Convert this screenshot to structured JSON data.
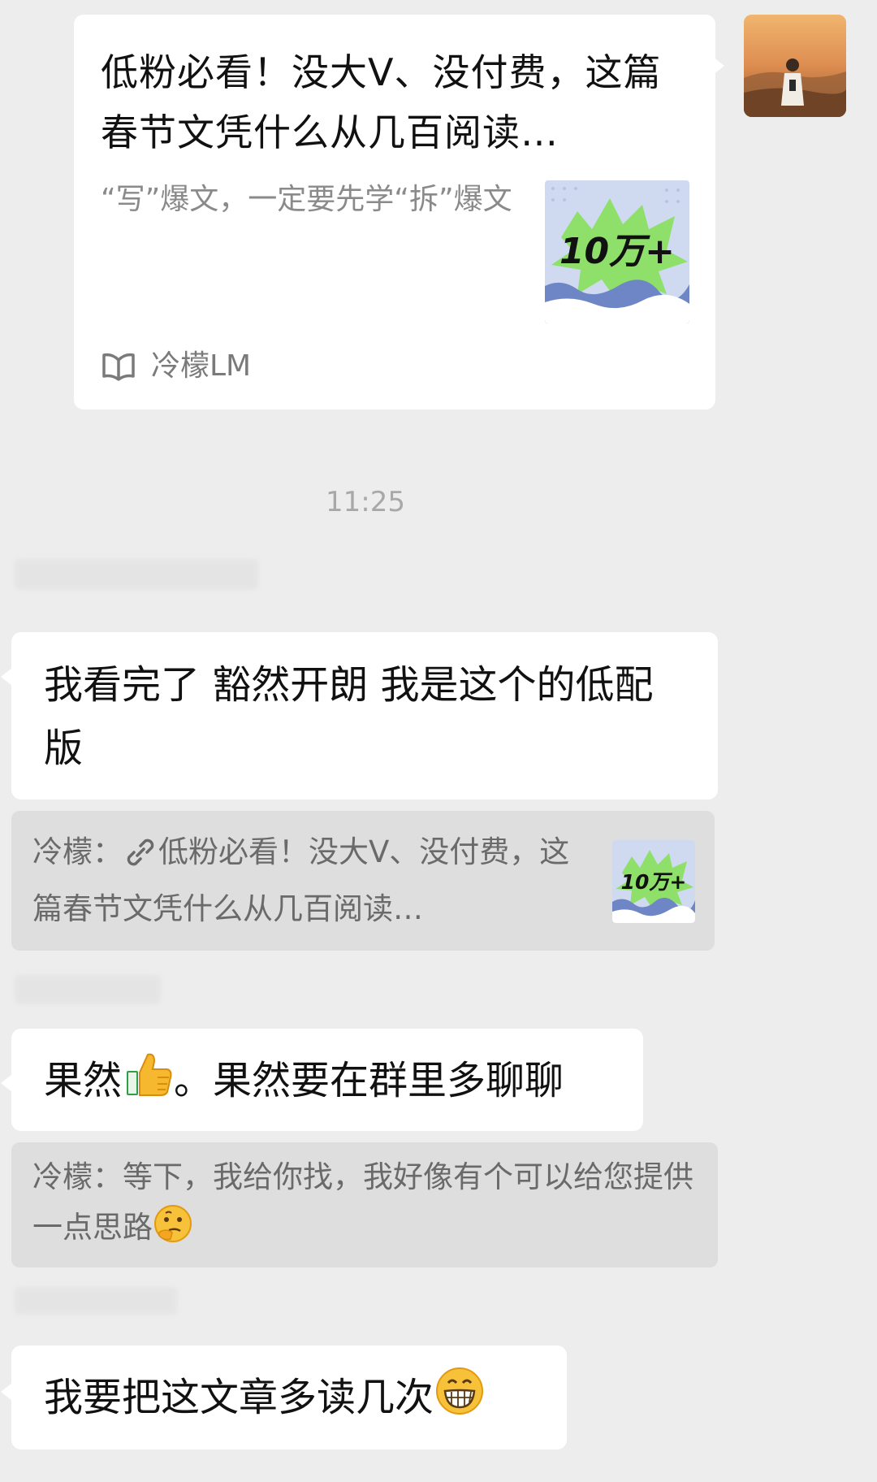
{
  "shared_article": {
    "title": "低粉必看！没大V、没付费，这篇春节文凭什么从几百阅读…",
    "description": "“写”爆文，一定要先学“拆”爆文",
    "source": "冷檬LM",
    "thumbnail_text": "10万+"
  },
  "timestamp": "11:25",
  "messages": [
    {
      "text": "我看完了 豁然开朗 我是这个的低配版",
      "quote": {
        "author": "冷檬：",
        "text": "低粉必看！没大V、没付费，这篇春节文凭什么从几百阅读…",
        "thumbnail_text": "10万+",
        "icon": "link-icon"
      }
    },
    {
      "text_before": "果然",
      "emoji": "thumbs-up-icon",
      "text_after": "。果然要在群里多聊聊",
      "quote": {
        "author": "冷檬：",
        "text": "等下，我给你找，我好像有个可以给您提供一点思路",
        "emoji": "thinking-face-icon"
      }
    },
    {
      "text": "我要把这文章多读几次",
      "emoji": "grinning-face-icon"
    }
  ],
  "colors": {
    "background": "#ededed",
    "bubble": "#ffffff",
    "quote_bg": "#dedede",
    "timestamp": "#a8a8a8"
  }
}
